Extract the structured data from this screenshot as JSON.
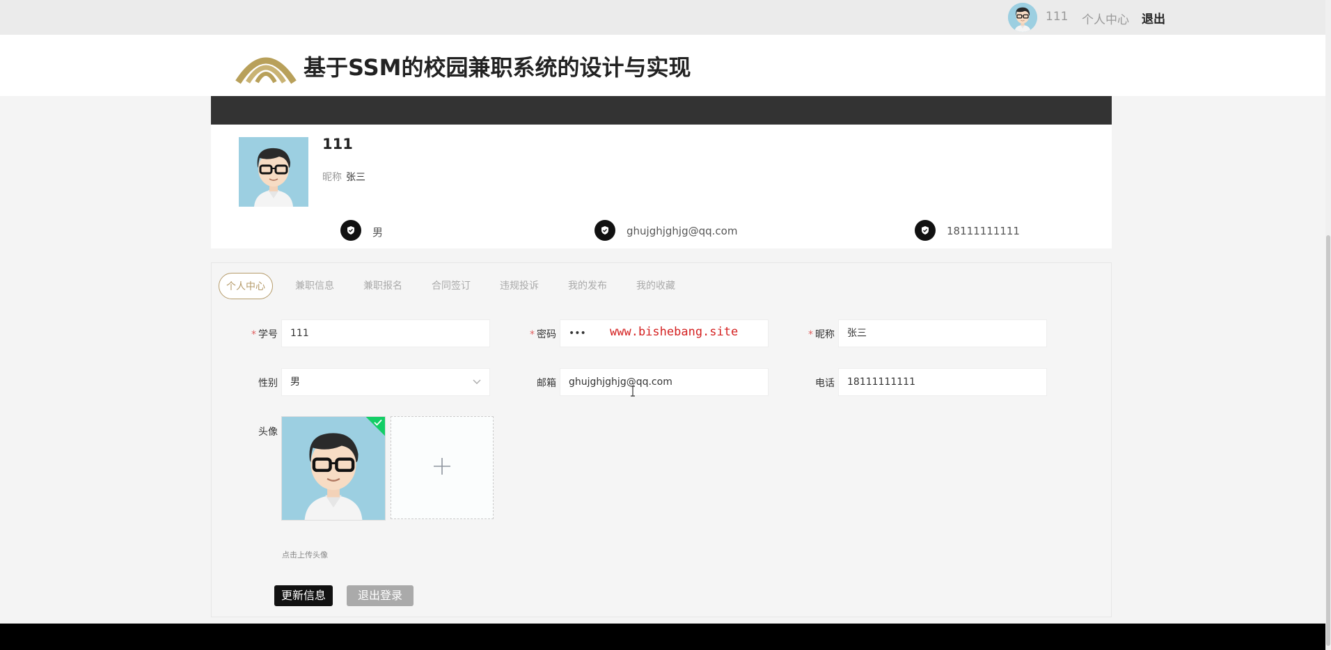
{
  "topbar": {
    "username": "111",
    "personal_center": "个人中心",
    "logout": "退出"
  },
  "header": {
    "title": "基于SSM的校园兼职系统的设计与实现"
  },
  "profile": {
    "name": "111",
    "nickname_label": "昵称",
    "nickname": "张三",
    "gender": "男",
    "email": "ghujghjghjg@qq.com",
    "phone": "18111111111"
  },
  "tabs": [
    {
      "label": "个人中心",
      "active": true
    },
    {
      "label": "兼职信息",
      "active": false
    },
    {
      "label": "兼职报名",
      "active": false
    },
    {
      "label": "合同签订",
      "active": false
    },
    {
      "label": "违规投诉",
      "active": false
    },
    {
      "label": "我的发布",
      "active": false
    },
    {
      "label": "我的收藏",
      "active": false
    }
  ],
  "form": {
    "student_id": {
      "label": "学号",
      "required": true,
      "value": "111"
    },
    "password": {
      "label": "密码",
      "required": true,
      "value": "•••"
    },
    "nickname": {
      "label": "昵称",
      "required": true,
      "value": "张三"
    },
    "gender": {
      "label": "性别",
      "value": "男"
    },
    "email": {
      "label": "邮箱",
      "value": "ghujghjghjg@qq.com"
    },
    "phone": {
      "label": "电话",
      "value": "18111111111"
    },
    "avatar": {
      "label": "头像",
      "hint": "点击上传头像"
    }
  },
  "watermark": "www.bishebang.site",
  "buttons": {
    "update": "更新信息",
    "logout": "退出登录"
  },
  "colors": {
    "accent_gold": "#b59b6a",
    "dark_band": "#333333",
    "success_green": "#13ce66",
    "required_red": "#e06060"
  },
  "icons": {
    "info_icon": "shield-icon",
    "upload_add": "plus-icon",
    "select_arrow": "chevron-down-icon",
    "upload_success": "check-icon"
  }
}
